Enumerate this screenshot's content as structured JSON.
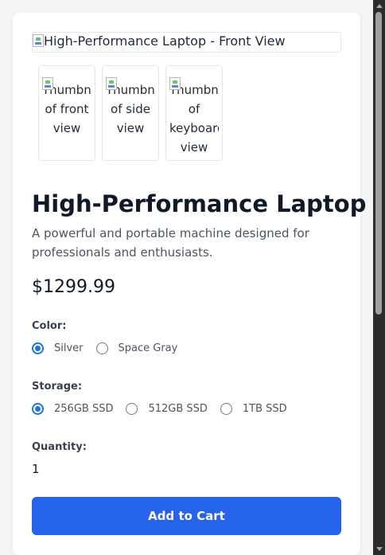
{
  "product": {
    "main_image_alt": "High-Performance Laptop - Front View",
    "thumbnails": [
      {
        "alt_first": "Thumbnail",
        "alt_rest": "of front view"
      },
      {
        "alt_first": "Thumbnail",
        "alt_rest": "of side view"
      },
      {
        "alt_first": "Thumbnail",
        "alt_rest": "of keyboard view"
      }
    ],
    "title": "High-Performance Laptop",
    "description": "A powerful and portable machine designed for professionals and enthusiasts.",
    "price": "$1299.99"
  },
  "options": {
    "color": {
      "label": "Color:",
      "choices": [
        "Silver",
        "Space Gray"
      ],
      "selected": "Silver"
    },
    "storage": {
      "label": "Storage:",
      "choices": [
        "256GB SSD",
        "512GB SSD",
        "1TB SSD"
      ],
      "selected": "256GB SSD"
    },
    "quantity": {
      "label": "Quantity:",
      "value": "1"
    }
  },
  "actions": {
    "add_to_cart_label": "Add to Cart"
  },
  "colors": {
    "page_bg": "#f3f4f6",
    "accent": "#2563eb",
    "radio_checked": "#1a73e8"
  }
}
